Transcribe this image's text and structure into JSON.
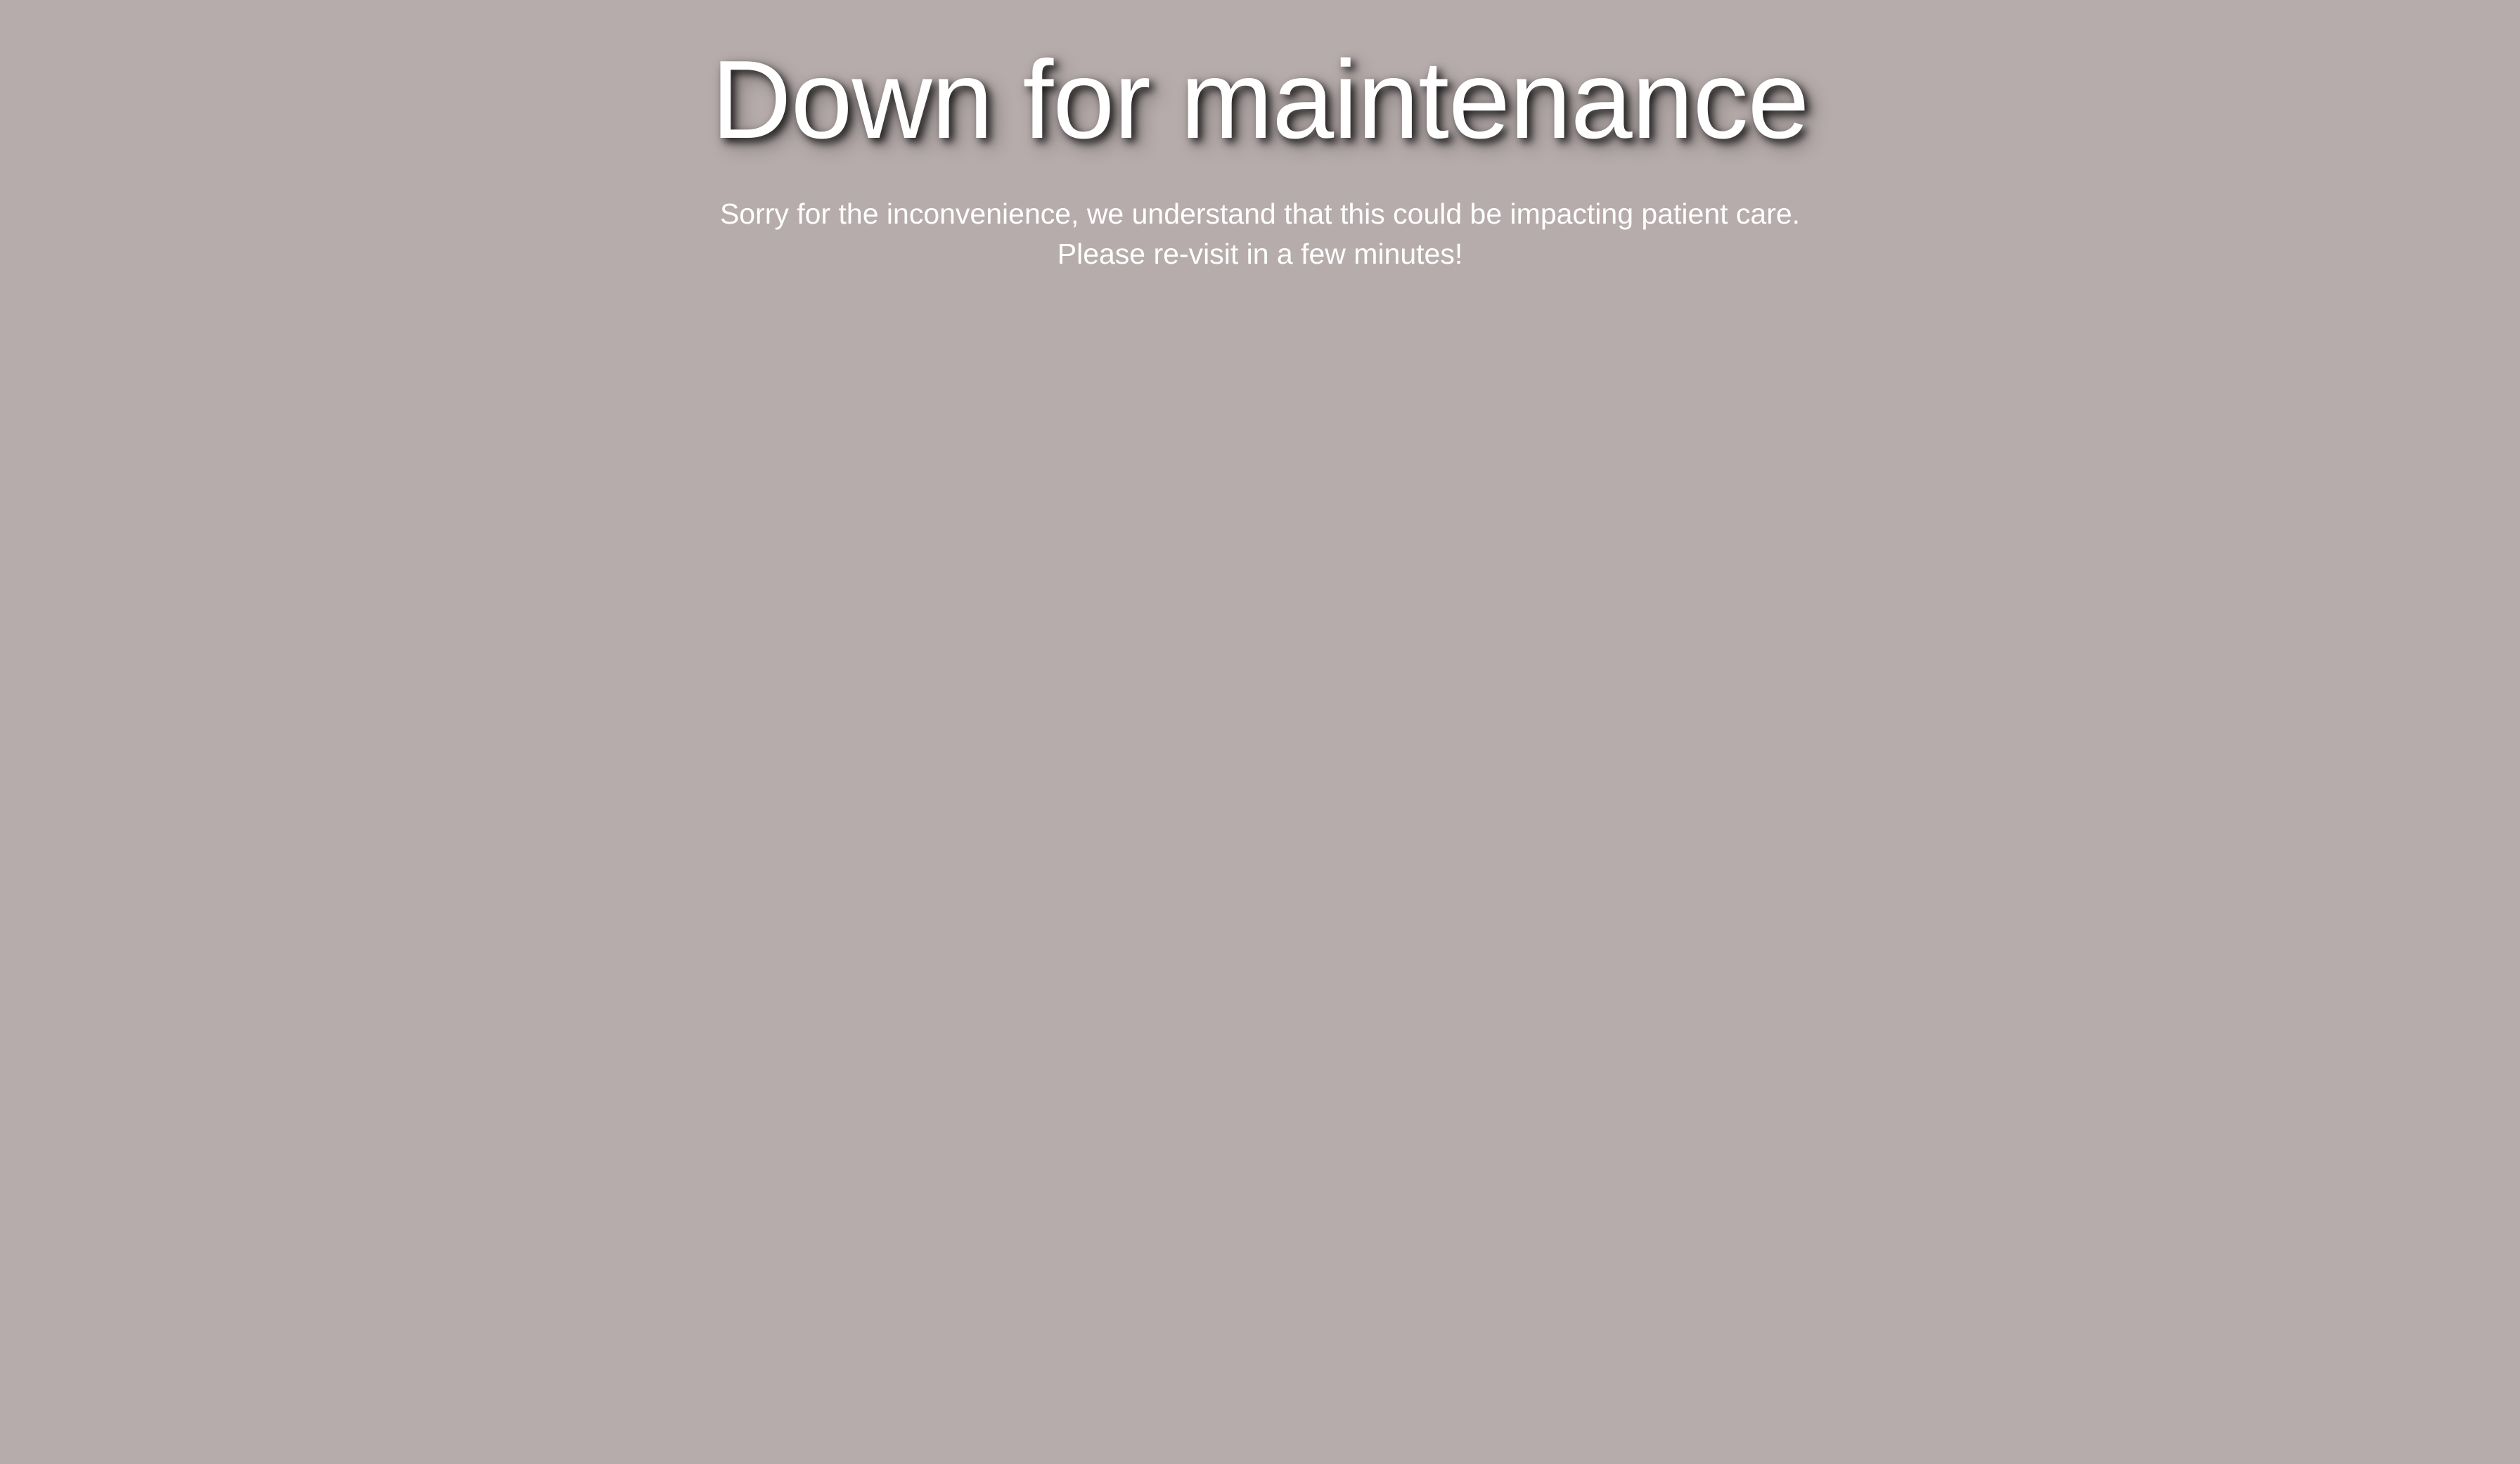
{
  "page": {
    "title": "Down for maintenance",
    "message_line_1": "Sorry for the inconvenience, we understand that this could be impacting patient care.",
    "message_line_2": "Please re-visit in a few minutes!"
  },
  "colors": {
    "background": "#b7acac",
    "text": "#ffffff",
    "title_shadow": "#000000"
  }
}
